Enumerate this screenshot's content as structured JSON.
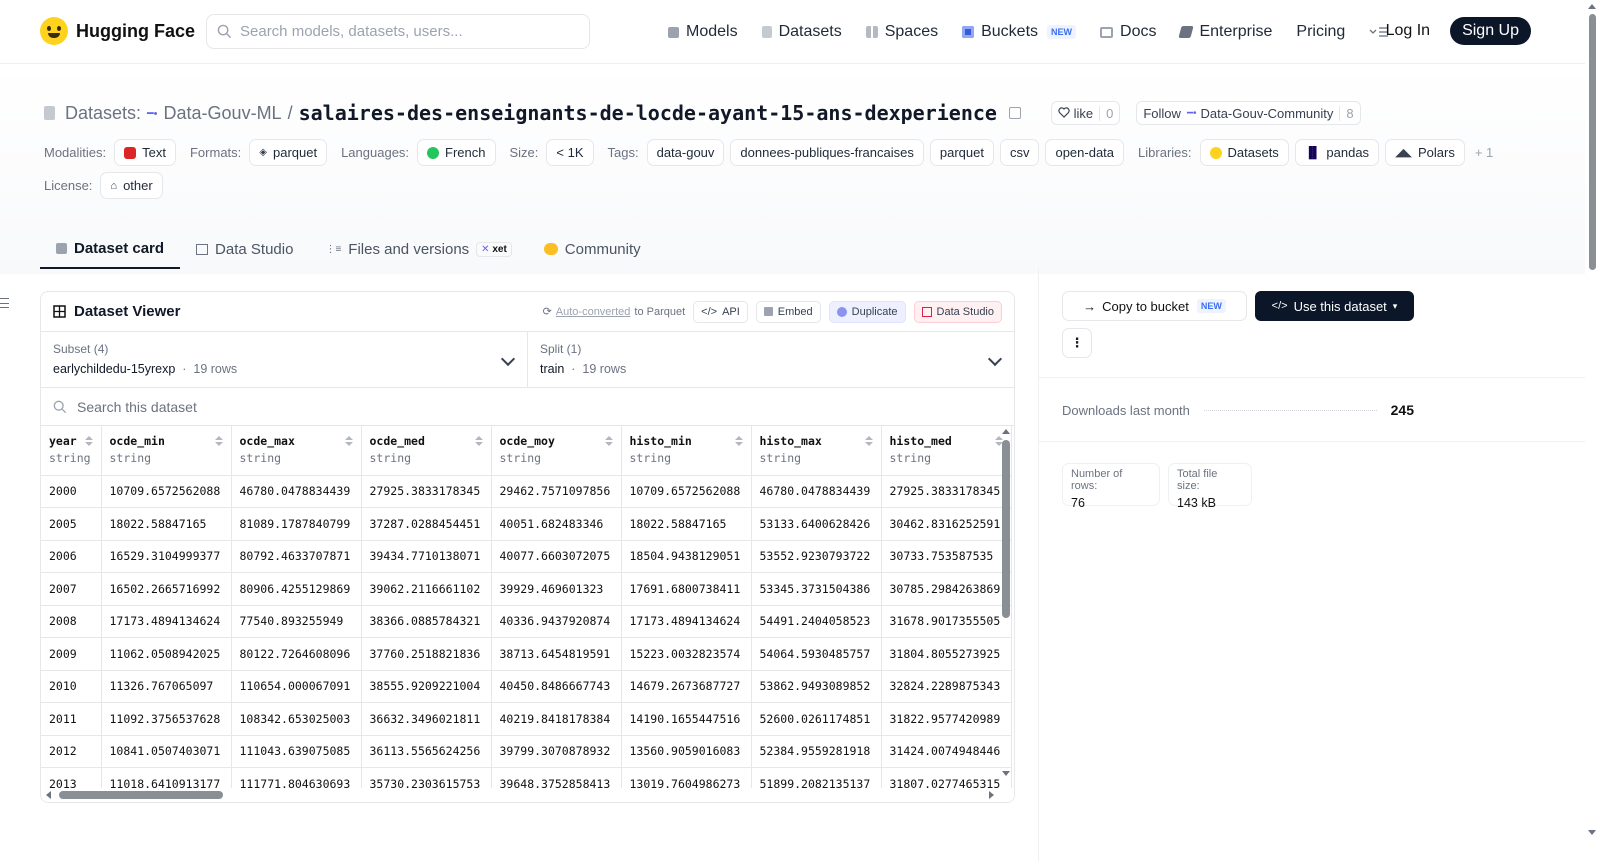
{
  "nav": {
    "brand": "Hugging Face",
    "search_placeholder": "Search models, datasets, users...",
    "links": [
      {
        "label": "Models",
        "icon": "cube-icon"
      },
      {
        "label": "Datasets",
        "icon": "database-icon"
      },
      {
        "label": "Spaces",
        "icon": "spaces-icon"
      },
      {
        "label": "Buckets",
        "icon": "bucket-icon",
        "badge": "NEW"
      },
      {
        "label": "Docs",
        "icon": "book-icon"
      },
      {
        "label": "Enterprise",
        "icon": "enterprise-icon"
      },
      {
        "label": "Pricing"
      }
    ],
    "login": "Log In",
    "signup": "Sign Up"
  },
  "header": {
    "section": "Datasets:",
    "org": "Data-Gouv-ML",
    "separator": "/",
    "repo": "salaires-des-enseignants-de-locde-ayant-15-ans-dexperience",
    "like_label": "like",
    "like_count": "0",
    "follow_label": "Follow",
    "follow_org": "Data-Gouv-Community",
    "follow_count": "8",
    "modalities_label": "Modalities:",
    "modality": "Text",
    "formats_label": "Formats:",
    "format": "parquet",
    "languages_label": "Languages:",
    "language": "French",
    "size_label": "Size:",
    "size": "< 1K",
    "tags_label": "Tags:",
    "tags": [
      "data-gouv",
      "donnees-publiques-francaises",
      "parquet",
      "csv",
      "open-data"
    ],
    "libraries_label": "Libraries:",
    "libraries": [
      "Datasets",
      "pandas",
      "Polars"
    ],
    "libraries_more": "+ 1",
    "license_label": "License:",
    "license": "other"
  },
  "tabs": [
    {
      "label": "Dataset card",
      "active": true
    },
    {
      "label": "Data Studio"
    },
    {
      "label": "Files and versions",
      "badge": "xet"
    },
    {
      "label": "Community"
    }
  ],
  "viewer": {
    "title": "Dataset Viewer",
    "auto_converted_link": "Auto-converted",
    "auto_converted_suffix": "to Parquet",
    "api_label": "API",
    "embed_label": "Embed",
    "duplicate_label": "Duplicate",
    "studio_label": "Data Studio",
    "subset_label": "Subset (4)",
    "subset_value": "earlychildedu-15yrexp",
    "subset_rows": "19 rows",
    "split_label": "Split (1)",
    "split_value": "train",
    "split_rows": "19 rows",
    "dot": "·",
    "search_placeholder": "Search this dataset",
    "columns": [
      {
        "name": "year",
        "type": "string"
      },
      {
        "name": "ocde_min",
        "type": "string"
      },
      {
        "name": "ocde_max",
        "type": "string"
      },
      {
        "name": "ocde_med",
        "type": "string"
      },
      {
        "name": "ocde_moy",
        "type": "string"
      },
      {
        "name": "histo_min",
        "type": "string"
      },
      {
        "name": "histo_max",
        "type": "string"
      },
      {
        "name": "histo_med",
        "type": "string"
      }
    ],
    "rows": [
      [
        "2000",
        "10709.6572562088",
        "46780.0478834439",
        "27925.3833178345",
        "29462.7571097856",
        "10709.6572562088",
        "46780.0478834439",
        "27925.3833178345"
      ],
      [
        "2005",
        "18022.58847165",
        "81089.1787840799",
        "37287.0288454451",
        "40051.682483346",
        "18022.58847165",
        "53133.6400628426",
        "30462.8316252591"
      ],
      [
        "2006",
        "16529.3104999377",
        "80792.4633707871",
        "39434.7710138071",
        "40077.6603072075",
        "18504.9438129051",
        "53552.9230793722",
        "30733.753587535"
      ],
      [
        "2007",
        "16502.2665716992",
        "80906.4255129869",
        "39062.2116661102",
        "39929.469601323",
        "17691.6800738411",
        "53345.3731504386",
        "30785.2984263869"
      ],
      [
        "2008",
        "17173.4894134624",
        "77540.893255949",
        "38366.0885784321",
        "40336.9437920874",
        "17173.4894134624",
        "54491.2404058523",
        "31678.9017355505"
      ],
      [
        "2009",
        "11062.0508942025",
        "80122.7264608096",
        "37760.2518821836",
        "38713.6454819591",
        "15223.0032823574",
        "54064.5930485757",
        "31804.8055273925"
      ],
      [
        "2010",
        "11326.767065097",
        "110654.000067091",
        "38555.9209221004",
        "40450.8486667743",
        "14679.2673687727",
        "53862.9493089852",
        "32824.2289875343"
      ],
      [
        "2011",
        "11092.3756537628",
        "108342.653025003",
        "36632.3496021811",
        "40219.8418178384",
        "14190.1655447516",
        "52600.0261174851",
        "31822.9577420989"
      ],
      [
        "2012",
        "10841.0507403071",
        "111043.639075085",
        "36113.5565624256",
        "39799.3070878932",
        "13560.9059016083",
        "52384.9559281918",
        "31424.0074948446"
      ],
      [
        "2013",
        "11018.6410913177",
        "111771.804630693",
        "35730.2303615753",
        "39648.3752858413",
        "13019.7604986273",
        "51899.2082135137",
        "31807.0277465315"
      ]
    ]
  },
  "sidebar": {
    "copy_bucket": "Copy to bucket",
    "copy_badge": "NEW",
    "use_dataset": "Use this dataset",
    "kebab": "⋮",
    "downloads_label": "Downloads last month",
    "downloads_value": "245",
    "rows_label": "Number of rows:",
    "rows_value": "76",
    "size_label": "Total file size:",
    "size_value": "143 kB"
  }
}
